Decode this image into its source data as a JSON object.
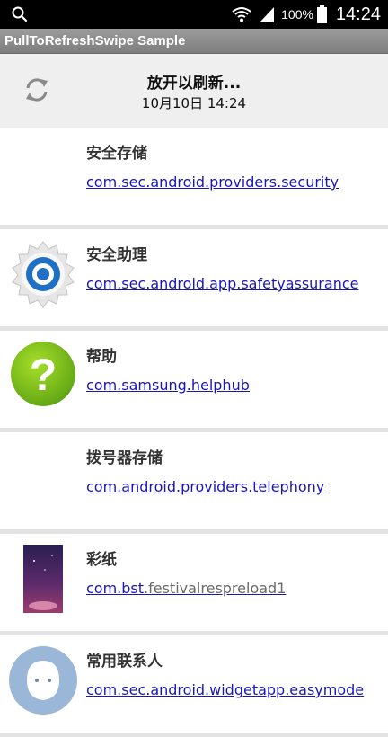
{
  "status_bar": {
    "battery_text": "100%",
    "time": "14:24",
    "icons": [
      "search-icon",
      "wifi-icon",
      "signal-icon",
      "battery-icon"
    ]
  },
  "app_bar": {
    "title": "PullToRefreshSwipe Sample"
  },
  "refresh_header": {
    "title": "放开以刷新...",
    "timestamp": "10月10日 14:24",
    "icon": "refresh-icon"
  },
  "items": [
    {
      "title": "安全存储",
      "link": "com.sec.android.providers.security",
      "icon": "none"
    },
    {
      "title": "安全助理",
      "link": "com.sec.android.app.safetyassurance",
      "icon": "gear-icon"
    },
    {
      "title": "帮助",
      "link": "com.samsung.helphub",
      "icon": "help-icon"
    },
    {
      "title": "拨号器存储",
      "link": "com.android.providers.telephony",
      "icon": "none"
    },
    {
      "title": "彩纸",
      "link_part1": "com.bst",
      "link_part2": ".festivalrespreload1",
      "icon": "wallpaper-thumbnail"
    },
    {
      "title": "常用联系人",
      "link": "com.sec.android.widgetapp.easymode",
      "icon": "contact-avatar-icon"
    }
  ],
  "colors": {
    "link": "#1a16b8",
    "header_bg": "#efefef",
    "divider": "#e3e3e3"
  }
}
